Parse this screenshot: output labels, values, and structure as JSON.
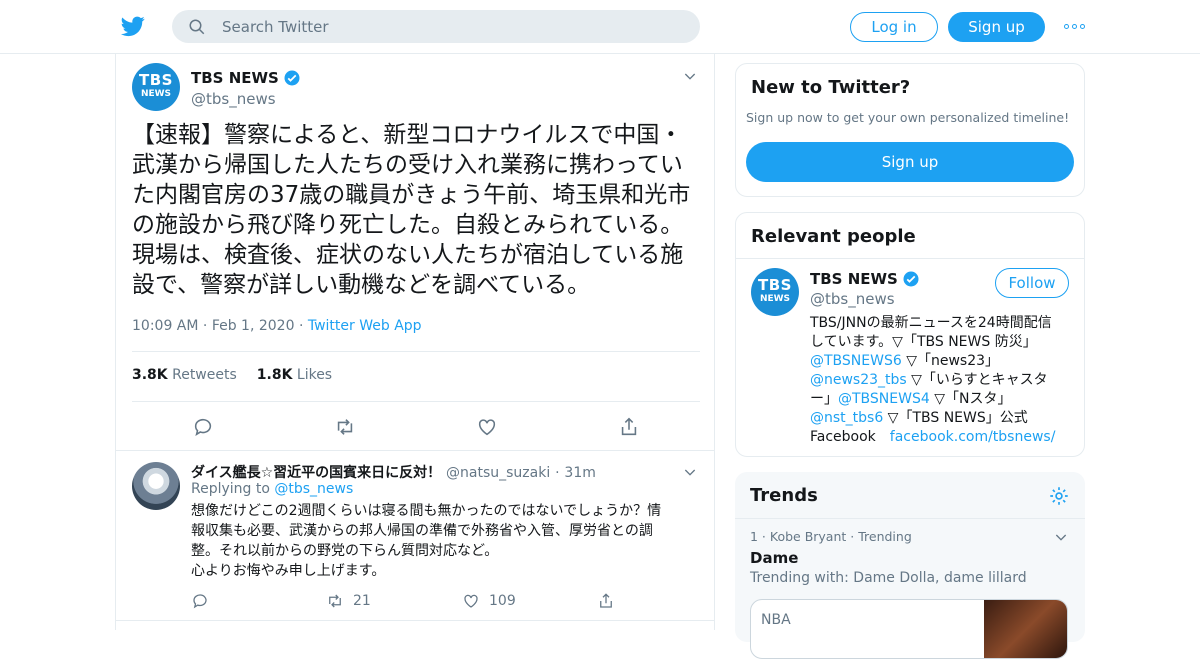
{
  "header": {
    "logo_icon": "twitter-bird-icon",
    "search_placeholder": "Search Twitter",
    "login_label": "Log in",
    "signup_label": "Sign up"
  },
  "tweet": {
    "avatar_text_top": "TBS",
    "avatar_text_bottom": "NEWS",
    "author_name": "TBS NEWS",
    "author_handle": "@tbs_news",
    "text": "【速報】警察によると、新型コロナウイルスで中国・武漢から帰国した人たちの受け入れ業務に携わっていた内閣官房の37歳の職員がきょう午前、埼玉県和光市の施設から飛び降り死亡した。自殺とみられている。現場は、検査後、症状のない人たちが宿泊している施設で、警察が詳しい動機などを調べている。",
    "time": "10:09 AM",
    "date": "Feb 1, 2020",
    "source": "Twitter Web App",
    "retweets_count": "3.8K",
    "retweets_label": "Retweets",
    "likes_count": "1.8K",
    "likes_label": "Likes"
  },
  "reply": {
    "author_name": "ダイス艦長☆習近平の国賓来日に反対！",
    "author_handle": "@natsu_suzaki",
    "age": "31m",
    "replying_prefix": "Replying to",
    "replying_to": "@tbs_news",
    "text_lines": [
      "想像だけどこの2週間くらいは寝る間も無かったのではないでしょうか？情",
      "報収集も必要、武漢からの邦人帰国の準備で外務省や入管、厚労省との調",
      "整。それ以前からの野党の下らん質問対応など。",
      "心よりお悔やみ申し上げます。"
    ],
    "retweets": "21",
    "likes": "109"
  },
  "new_to_twitter": {
    "title": "New to Twitter?",
    "subtitle": "Sign up now to get your own personalized timeline!",
    "button": "Sign up"
  },
  "relevant_people": {
    "title": "Relevant people",
    "name": "TBS NEWS",
    "handle": "@tbs_news",
    "follow_label": "Follow",
    "bio": {
      "l1": "TBS/JNNの最新ニュースを24時間配信",
      "l2": "しています。▽「TBS NEWS 防災」",
      "m1": "@TBSNEWS6",
      "l3": " ▽「news23」",
      "m2": "@news23_tbs",
      "l4": " ▽「いらすとキャスタ",
      "l5": "ー」",
      "m3": "@TBSNEWS4",
      "l6": " ▽「Nスタ」",
      "m4": "@nst_tbs6",
      "l7": " ▽「TBS NEWS」公式",
      "l8": "Facebook　",
      "link": "facebook.com/tbsnews/"
    }
  },
  "trends": {
    "title": "Trends",
    "item_meta": "1 · Kobe Bryant · Trending",
    "item_name": "Dame",
    "item_with": "Trending with: Dame Dolla, dame lillard",
    "card_label": "NBA"
  },
  "colors": {
    "accent": "#1da1f2",
    "text": "#14171a",
    "muted": "#657786",
    "border": "#e6ecf0"
  }
}
